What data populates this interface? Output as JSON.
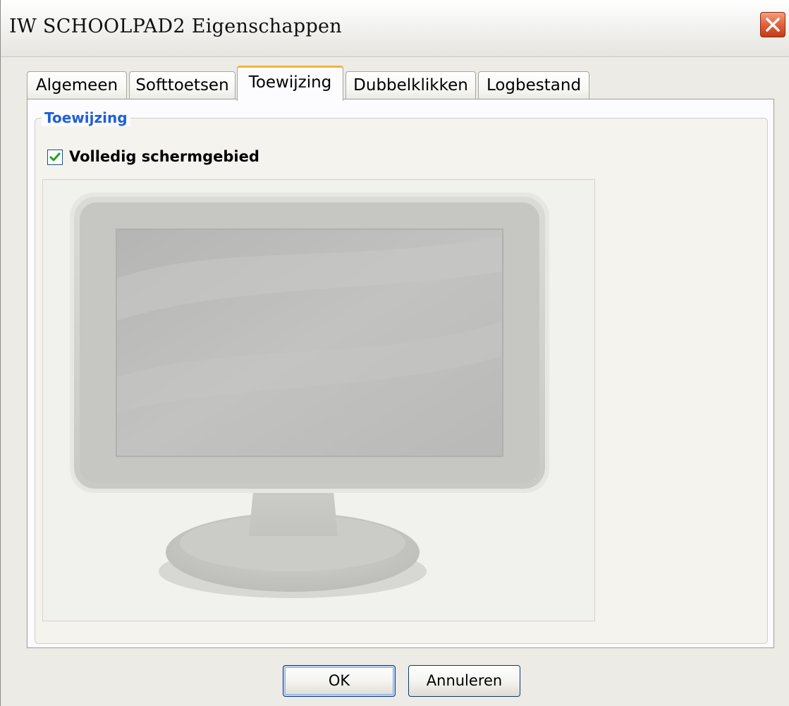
{
  "window": {
    "title": "IW SCHOOLPAD2 Eigenschappen"
  },
  "tabs": [
    {
      "label": "Algemeen",
      "active": false
    },
    {
      "label": "Softtoetsen",
      "active": false
    },
    {
      "label": "Toewijzing",
      "active": true
    },
    {
      "label": "Dubbelklikken",
      "active": false
    },
    {
      "label": "Logbestand",
      "active": false
    }
  ],
  "group": {
    "label": "Toewijzing",
    "checkbox_label": "Volledig schermgebied",
    "checkbox_checked": true
  },
  "buttons": {
    "ok": "OK",
    "cancel": "Annuleren"
  },
  "colors": {
    "group_label": "#1f5fd8",
    "active_tab_accent": "#f2b33d",
    "checkmark": "#21a121",
    "close_button": "#e0603b"
  },
  "icons": {
    "close": "close-x-icon",
    "check": "checkmark-icon",
    "monitor": "monitor-illustration"
  }
}
